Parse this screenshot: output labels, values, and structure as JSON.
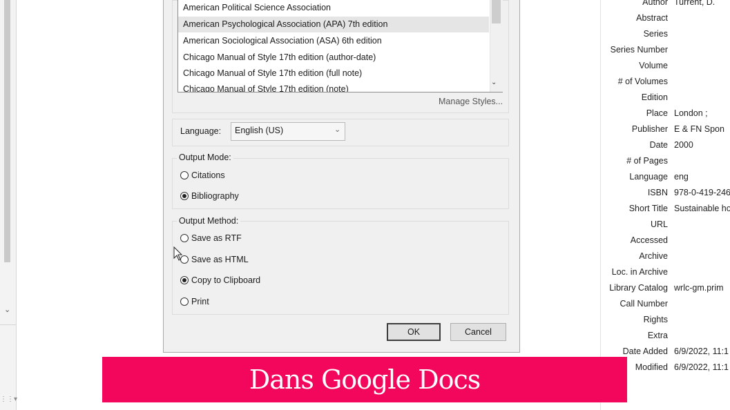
{
  "styles": {
    "items": [
      "American Political Science Association",
      "American Psychological Association (APA) 7th edition",
      "American Sociological Association (ASA) 6th edition",
      "Chicago Manual of Style 17th edition (author-date)",
      "Chicago Manual of Style 17th edition (full note)",
      "Chicago Manual of Style 17th edition (note)"
    ],
    "manage_label": "Manage Styles..."
  },
  "language": {
    "label": "Language:",
    "value": "English (US)"
  },
  "output_mode": {
    "title": "Output Mode:",
    "options": [
      "Citations",
      "Bibliography"
    ],
    "selected": "Bibliography"
  },
  "output_method": {
    "title": "Output Method:",
    "options": [
      "Save as RTF",
      "Save as HTML",
      "Copy to Clipboard",
      "Print"
    ],
    "selected": "Copy to Clipboard"
  },
  "buttons": {
    "ok": "OK",
    "cancel": "Cancel"
  },
  "info": {
    "rows": [
      {
        "key": "Author",
        "value": "Turrent, D."
      },
      {
        "key": "Abstract",
        "value": ""
      },
      {
        "key": "Series",
        "value": ""
      },
      {
        "key": "Series Number",
        "value": ""
      },
      {
        "key": "Volume",
        "value": ""
      },
      {
        "key": "# of Volumes",
        "value": ""
      },
      {
        "key": "Edition",
        "value": ""
      },
      {
        "key": "Place",
        "value": "London ;"
      },
      {
        "key": "Publisher",
        "value": "E & FN Spon"
      },
      {
        "key": "Date",
        "value": "2000"
      },
      {
        "key": "# of Pages",
        "value": ""
      },
      {
        "key": "Language",
        "value": "eng"
      },
      {
        "key": "ISBN",
        "value": "978-0-419-246"
      },
      {
        "key": "Short Title",
        "value": "Sustainable ho"
      },
      {
        "key": "URL",
        "value": ""
      },
      {
        "key": "Accessed",
        "value": ""
      },
      {
        "key": "Archive",
        "value": ""
      },
      {
        "key": "Loc. in Archive",
        "value": ""
      },
      {
        "key": "Library Catalog",
        "value": "wrlc-gm.prim"
      },
      {
        "key": "Call Number",
        "value": ""
      },
      {
        "key": "Rights",
        "value": ""
      },
      {
        "key": "Extra",
        "value": ""
      },
      {
        "key": "Date Added",
        "value": "6/9/2022, 11:1"
      },
      {
        "key": "Modified",
        "value": "6/9/2022, 11:1"
      }
    ]
  },
  "banner": {
    "text": "Dans Google Docs",
    "color": "#f2075c"
  }
}
